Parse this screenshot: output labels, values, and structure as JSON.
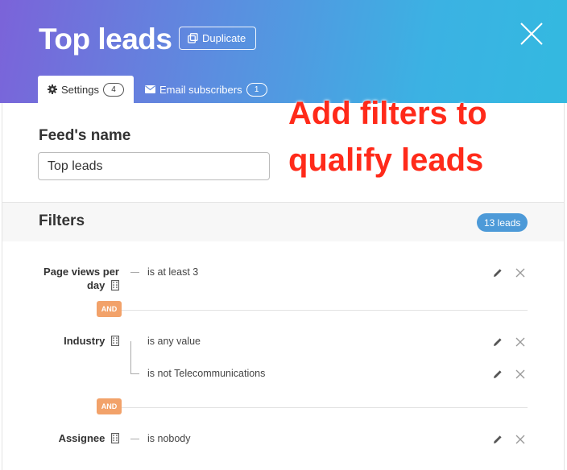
{
  "header": {
    "title": "Top leads",
    "duplicate_label": "Duplicate"
  },
  "tabs": [
    {
      "label": "Settings",
      "count": "4",
      "icon": "gear-icon",
      "active": true
    },
    {
      "label": "Email subscribers",
      "count": "1",
      "icon": "envelope-icon",
      "active": false
    }
  ],
  "annotation": {
    "line1": "Add filters to",
    "line2": "qualify leads"
  },
  "feed": {
    "label": "Feed's name",
    "value": "Top leads"
  },
  "filters": {
    "title": "Filters",
    "leads_count": "13 leads",
    "and_label": "AND",
    "items": [
      {
        "name_line1": "Page views per",
        "name_line2": "day",
        "conditions": [
          "is at least  3"
        ]
      },
      {
        "name_line1": "Industry",
        "conditions": [
          "is any value",
          "is not  Telecommunications"
        ]
      },
      {
        "name_line1": "Assignee",
        "conditions": [
          "is nobody"
        ]
      }
    ]
  },
  "colors": {
    "accent_blue": "#4d9ad8",
    "and_orange": "#f2a26a",
    "annotation_red": "#ff2a1a"
  }
}
